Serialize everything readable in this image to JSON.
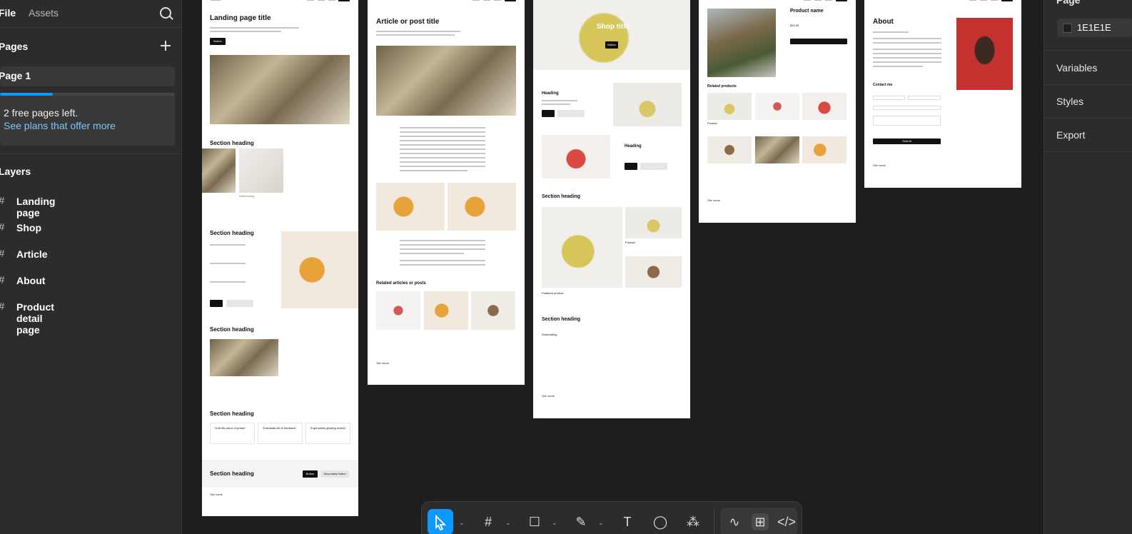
{
  "left_panel": {
    "tabs": {
      "file": "File",
      "assets": "Assets"
    },
    "pages_heading": "Pages",
    "current_page": "Page 1",
    "free_pages_fraction": 0.3,
    "free_pages_text": "2 free pages left.",
    "plans_link": "See plans that offer more",
    "layers_heading": "Layers",
    "layers": [
      {
        "label": "Landing page"
      },
      {
        "label": "Shop"
      },
      {
        "label": "Article"
      },
      {
        "label": "About"
      },
      {
        "label": "Product detail page"
      }
    ]
  },
  "right_panel": {
    "page_heading": "Page",
    "bg_color": "1E1E1E",
    "items": [
      "Variables",
      "Styles",
      "Export"
    ]
  },
  "frames": {
    "landing": {
      "title": "Landing page title",
      "button": "Button",
      "section1": "Section heading",
      "sub1": "Subheading",
      "section2": "Section heading",
      "section3": "Section heading",
      "section4": "Section heading",
      "quotes": [
        "\"A terrific piece of praise\"",
        "\"A fantastic bit of feedback\"",
        "\"A genuinely glowing review\""
      ],
      "section5": "Section heading",
      "btn_primary": "Button",
      "btn_secondary": "Secondary button",
      "site": "Site name"
    },
    "article": {
      "title": "Article or post title",
      "related": "Related articles or posts",
      "site": "Site name"
    },
    "shop": {
      "title": "Shop title",
      "button": "Button",
      "heading1": "Heading",
      "heading2": "Heading",
      "section1": "Section heading",
      "featured": "Featured product",
      "product": "Product",
      "section2": "Section heading",
      "sub": "Subheading",
      "site": "Site name"
    },
    "product": {
      "name": "Product name",
      "price": "$10.99",
      "related": "Related products",
      "item": "Product",
      "site": "Site name"
    },
    "about": {
      "title": "About",
      "contact": "Contact me",
      "submit": "Submit",
      "site": "Site name"
    }
  },
  "toolbar": {
    "tools": [
      "move-tool",
      "frame-tool",
      "shape-tool",
      "pen-tool",
      "text-tool",
      "comment-tool",
      "actions-tool"
    ]
  }
}
